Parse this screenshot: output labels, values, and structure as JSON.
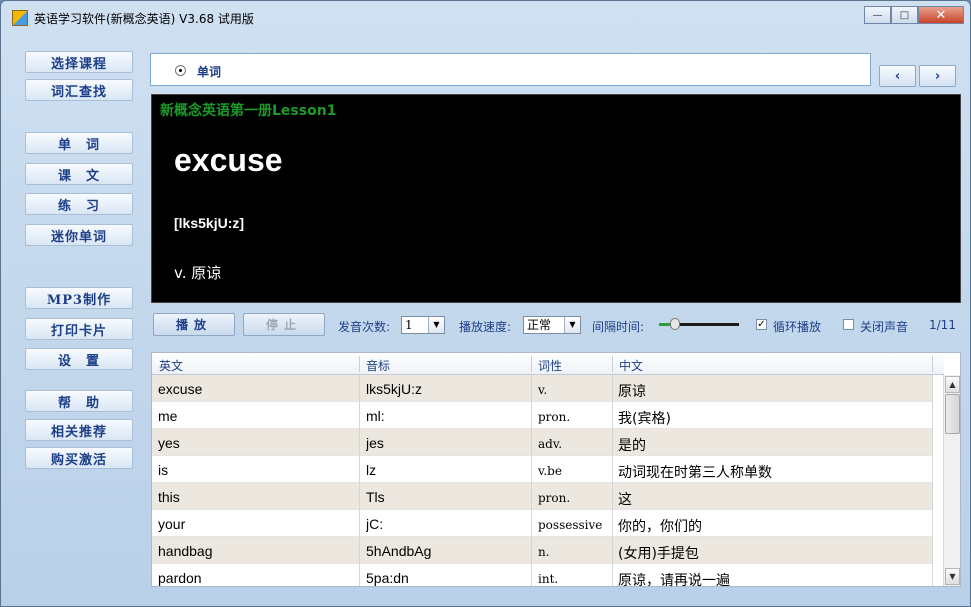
{
  "window": {
    "title": "英语学习软件(新概念英语) V3.68 试用版",
    "minimize": "—",
    "maximize": "□",
    "close": "✕"
  },
  "nav": {
    "select_course": "选择课程",
    "vocab_search": "词汇查找",
    "words": "单　词",
    "text": "课　文",
    "exercise": "练　习",
    "mini_words": "迷你单词",
    "mp3": "MP3制作",
    "print_cards": "打印卡片",
    "settings": "设　置",
    "help": "帮　助",
    "recommend": "相关推荐",
    "buy": "购买激活"
  },
  "mode": {
    "label": "单词",
    "prev": "‹",
    "next": "›"
  },
  "display": {
    "lesson": "新概念英语第一册Lesson1",
    "word": "excuse",
    "phonetic": "[lks5kjU:z]",
    "meaning": "v. 原谅"
  },
  "controls": {
    "play": "播放",
    "stop": "停止",
    "repeat_label": "发音次数:",
    "repeat_value": "1",
    "speed_label": "播放速度:",
    "speed_value": "正常",
    "interval_label": "间隔时间:",
    "interval_level": 0.2,
    "loop_label": "循环播放",
    "loop_checked": true,
    "mute_label": "关闭声音",
    "mute_checked": false,
    "page": "1/11",
    "check_mark": "✓"
  },
  "table": {
    "headers": [
      "英文",
      "音标",
      "词性",
      "中文"
    ],
    "rows": [
      {
        "en": "excuse",
        "ph": "lks5kjU:z",
        "pos": "v.",
        "cn": "原谅"
      },
      {
        "en": "me",
        "ph": "ml:",
        "pos": "pron.",
        "cn": "我(宾格)"
      },
      {
        "en": "yes",
        "ph": "jes",
        "pos": "adv.",
        "cn": "是的"
      },
      {
        "en": "is",
        "ph": "lz",
        "pos": "v.be",
        "cn": "动词现在时第三人称单数"
      },
      {
        "en": "this",
        "ph": "Tls",
        "pos": "pron.",
        "cn": "这"
      },
      {
        "en": "your",
        "ph": "jC:",
        "pos": "possessive",
        "cn": "你的，你们的"
      },
      {
        "en": "handbag",
        "ph": "5hAndbAg",
        "pos": "n.",
        "cn": "(女用)手提包"
      },
      {
        "en": "pardon",
        "ph": "5pa:dn",
        "pos": "int.",
        "cn": "原谅，请再说一遍"
      }
    ]
  },
  "scroll": {
    "up": "▲",
    "down": "▼"
  },
  "dropdown_arrow": "▼",
  "radio_icon": "radio-selected"
}
